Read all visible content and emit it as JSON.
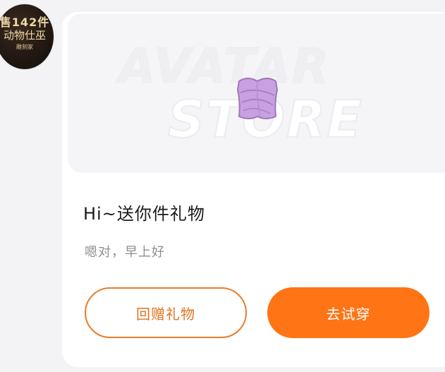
{
  "avatar": {
    "line1": "售142件",
    "line2": "动物仕巫",
    "line3": "雕刻家"
  },
  "banner": {
    "watermark_line1": "AVATAR",
    "watermark_line2": "STORE",
    "item_color": "#c9a1e2"
  },
  "message": {
    "title": "Hi~送你件礼物",
    "subtitle": "嗯对，早上好"
  },
  "actions": {
    "return_gift_label": "回赠礼物",
    "try_on_label": "去试穿"
  },
  "colors": {
    "accent": "#ff7415",
    "accent_border": "#e87d2a"
  }
}
